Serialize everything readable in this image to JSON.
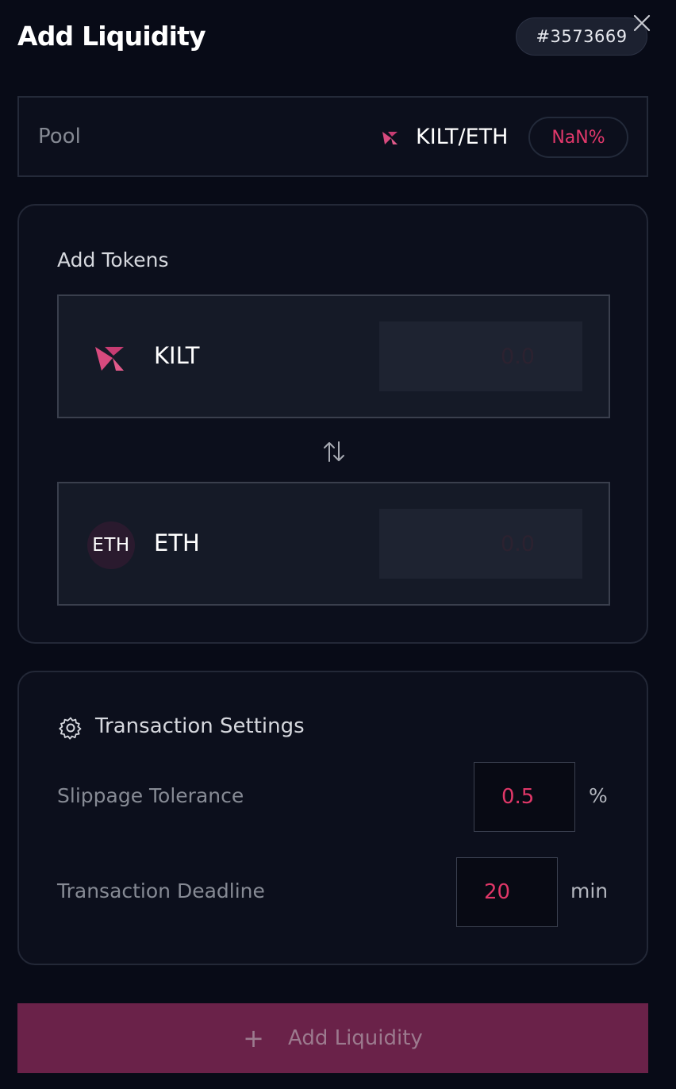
{
  "header": {
    "title": "Add Liquidity",
    "position_id": "#3573669",
    "close_icon": "close-icon"
  },
  "pool": {
    "label": "Pool",
    "pair": "KILT/ETH",
    "fee": "NaN%",
    "icon": "kilt-logo-icon"
  },
  "add_tokens": {
    "title": "Add Tokens",
    "swap_icon": "swap-arrows-icon",
    "tokens": [
      {
        "symbol": "KILT",
        "icon": "kilt-logo-icon",
        "placeholder": "0.0"
      },
      {
        "symbol": "ETH",
        "icon_text": "ETH",
        "placeholder": "0.0"
      }
    ]
  },
  "settings": {
    "title": "Transaction Settings",
    "icon": "gear-icon",
    "slippage": {
      "label": "Slippage Tolerance",
      "value": "0.5",
      "unit": "%"
    },
    "deadline": {
      "label": "Transaction Deadline",
      "value": "20",
      "unit": "min"
    }
  },
  "submit": {
    "label": "Add Liquidity",
    "icon": "plus-icon"
  },
  "colors": {
    "accent": "#e2386b",
    "button_bg": "#6a2249",
    "background": "#080b17"
  }
}
